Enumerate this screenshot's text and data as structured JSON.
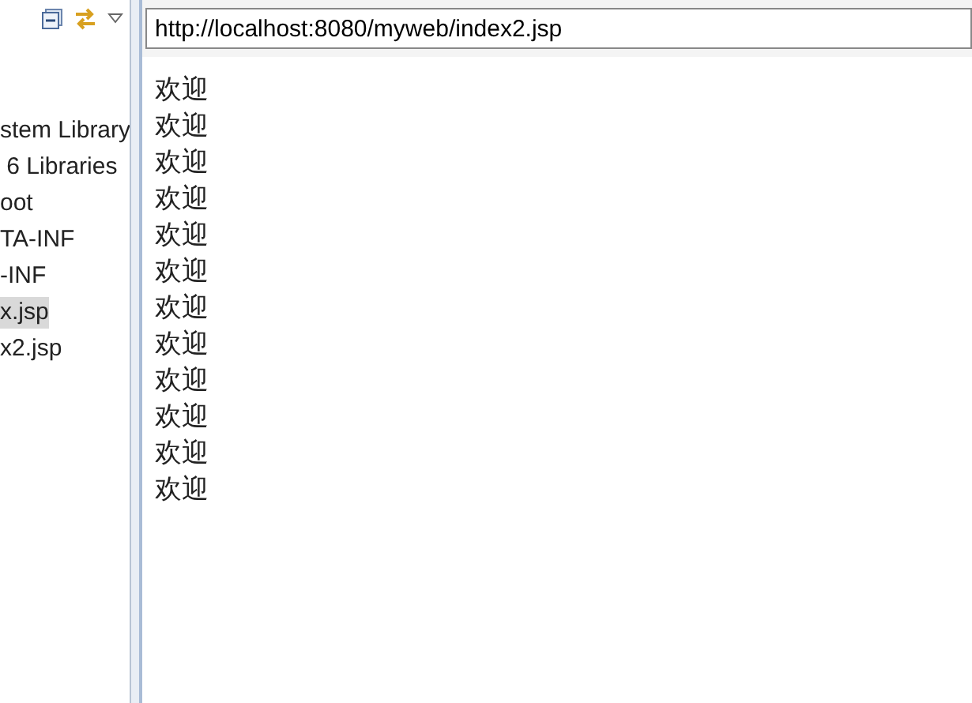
{
  "tree": {
    "items": [
      {
        "label": "stem Library",
        "selected": false
      },
      {
        "label": " 6 Libraries",
        "selected": false
      },
      {
        "label": "oot",
        "selected": false
      },
      {
        "label": "TA-INF",
        "selected": false
      },
      {
        "label": "-INF",
        "selected": false
      },
      {
        "label": "x.jsp",
        "selected": true
      },
      {
        "label": "x2.jsp",
        "selected": false
      }
    ]
  },
  "browser": {
    "url": "http://localhost:8080/myweb/index2.jsp",
    "lines": [
      "欢迎",
      "欢迎",
      "欢迎",
      "欢迎",
      "欢迎",
      "欢迎",
      "欢迎",
      "欢迎",
      "欢迎",
      "欢迎",
      "欢迎",
      "欢迎"
    ]
  }
}
